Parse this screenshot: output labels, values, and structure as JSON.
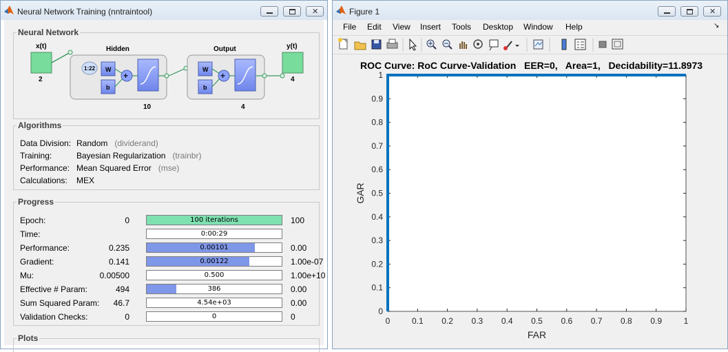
{
  "left_window": {
    "title": "Neural Network Training (nntraintool)",
    "sections": {
      "network": "Neural Network",
      "algorithms": "Algorithms",
      "progress": "Progress",
      "plots": "Plots"
    },
    "diagram": {
      "input_label": "x(t)",
      "input_size": "2",
      "hidden_title": "Hidden",
      "hidden_delay": "1:22",
      "hidden_w": "W",
      "hidden_b": "b",
      "hidden_size": "10",
      "output_title": "Output",
      "output_w": "W",
      "output_b": "b",
      "output_size": "4",
      "output_label": "y(t)",
      "output_count": "4"
    },
    "algorithms": [
      {
        "label": "Data Division:",
        "value": "Random",
        "func": "(dividerand)"
      },
      {
        "label": "Training:",
        "value": "Bayesian Regularization",
        "func": "(trainbr)"
      },
      {
        "label": "Performance:",
        "value": "Mean Squared Error",
        "func": "(mse)"
      },
      {
        "label": "Calculations:",
        "value": "MEX",
        "func": ""
      }
    ],
    "progress": [
      {
        "label": "Epoch:",
        "start": "0",
        "bar": "100 iterations",
        "end": "100",
        "fill": 1.0,
        "color": "#7fe0b0"
      },
      {
        "label": "Time:",
        "start": "",
        "bar": "0:00:29",
        "end": "",
        "fill": 0,
        "color": "#7f97e8"
      },
      {
        "label": "Performance:",
        "start": "0.235",
        "bar": "0.00101",
        "end": "0.00",
        "fill": 0.8,
        "color": "#7f97e8"
      },
      {
        "label": "Gradient:",
        "start": "0.141",
        "bar": "0.00122",
        "end": "1.00e-07",
        "fill": 0.76,
        "color": "#7f97e8"
      },
      {
        "label": "Mu:",
        "start": "0.00500",
        "bar": "0.500",
        "end": "1.00e+10",
        "fill": 0,
        "color": "#7f97e8"
      },
      {
        "label": "Effective # Param:",
        "start": "494",
        "bar": "386",
        "end": "0.00",
        "fill": 0.22,
        "color": "#7f97e8"
      },
      {
        "label": "Sum Squared Param:",
        "start": "46.7",
        "bar": "4.54e+03",
        "end": "0.00",
        "fill": 0,
        "color": "#7f97e8"
      },
      {
        "label": "Validation Checks:",
        "start": "0",
        "bar": "0",
        "end": "0",
        "fill": 0,
        "color": "#7f97e8"
      }
    ]
  },
  "right_window": {
    "title": "Figure 1",
    "menu": [
      "File",
      "Edit",
      "View",
      "Insert",
      "Tools",
      "Desktop",
      "Window",
      "Help"
    ],
    "toolbar_icons": [
      "new-file-icon",
      "open-folder-icon",
      "save-icon",
      "print-icon",
      "pointer-icon",
      "zoom-in-icon",
      "zoom-out-icon",
      "pan-hand-icon",
      "rotate-3d-icon",
      "data-cursor-icon",
      "brush-icon",
      "link-plot-icon",
      "colorbar-icon",
      "legend-icon",
      "hide-tools-icon",
      "show-tools-icon"
    ]
  },
  "chart_data": {
    "type": "line",
    "title": "ROC Curve: RoC Curve-Validation   EER=0,   Area=1,   Decidability=11.8973",
    "xlabel": "FAR",
    "ylabel": "GAR",
    "xlim": [
      0,
      1
    ],
    "ylim": [
      0,
      1
    ],
    "xticks": [
      "0",
      "0.1",
      "0.2",
      "0.3",
      "0.4",
      "0.5",
      "0.6",
      "0.7",
      "0.8",
      "0.9",
      "1"
    ],
    "yticks": [
      "0",
      "0.1",
      "0.2",
      "0.3",
      "0.4",
      "0.5",
      "0.6",
      "0.7",
      "0.8",
      "0.9",
      "1"
    ],
    "grid": false,
    "series": [
      {
        "x": [
          0,
          0,
          1
        ],
        "y": [
          0,
          1,
          1
        ],
        "color": "#0072bd"
      }
    ]
  }
}
